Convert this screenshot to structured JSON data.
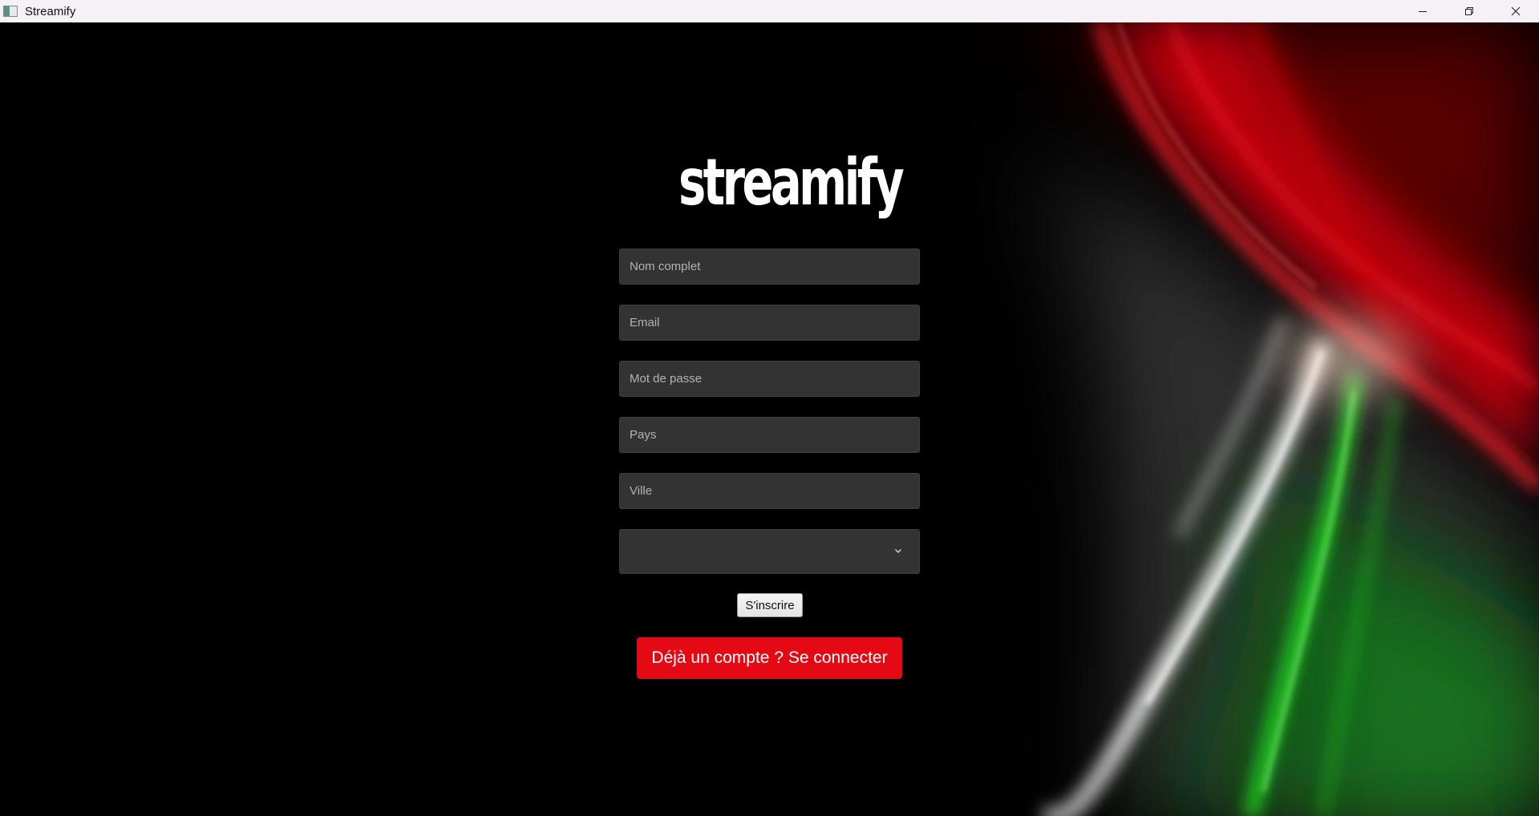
{
  "window": {
    "title": "Streamify",
    "controls": [
      "minimize-icon",
      "restore-icon",
      "close-icon"
    ]
  },
  "logo": {
    "wordmark": "streamify"
  },
  "form": {
    "full_name_placeholder": "Nom complet",
    "email_placeholder": "Email",
    "password_placeholder": "Mot de passe",
    "country_placeholder": "Pays",
    "city_placeholder": "Ville",
    "select_value": "",
    "signup_label": "S'inscrire",
    "login_label": "Déjà un compte ? Se connecter"
  },
  "colors": {
    "background": "#000000",
    "field_background": "#333333",
    "accent_red": "#e50914",
    "title_bar": "#f5f1f7"
  }
}
